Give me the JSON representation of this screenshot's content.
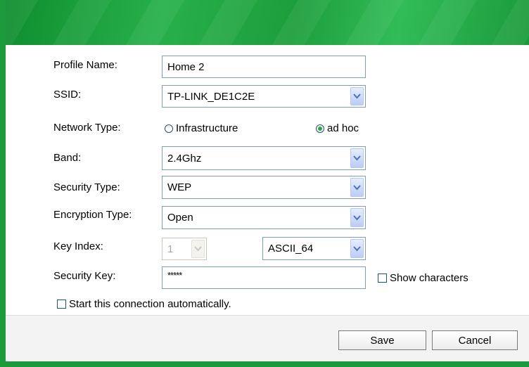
{
  "form": {
    "profile_name": {
      "label": "Profile Name:",
      "value": "Home 2"
    },
    "ssid": {
      "label": "SSID:",
      "value": "TP-LINK_DE1C2E"
    },
    "network_type": {
      "label": "Network Type:",
      "options": [
        "Infrastructure",
        "ad hoc"
      ],
      "selected": "ad hoc"
    },
    "band": {
      "label": "Band:",
      "value": "2.4Ghz"
    },
    "security_type": {
      "label": "Security Type:",
      "value": "WEP"
    },
    "encryption_type": {
      "label": "Encryption Type:",
      "value": "Open"
    },
    "key_index": {
      "label": "Key Index:",
      "value": "1",
      "key_format": "ASCII_64"
    },
    "security_key": {
      "label": "Security Key:",
      "value": "*****",
      "show_characters_label": "Show characters"
    },
    "auto_connect_label": "Start this connection automatically."
  },
  "buttons": {
    "save": "Save",
    "cancel": "Cancel"
  },
  "colors": {
    "accent_green": "#1a9a3a",
    "arrow_blue": "#4d6fbf"
  }
}
